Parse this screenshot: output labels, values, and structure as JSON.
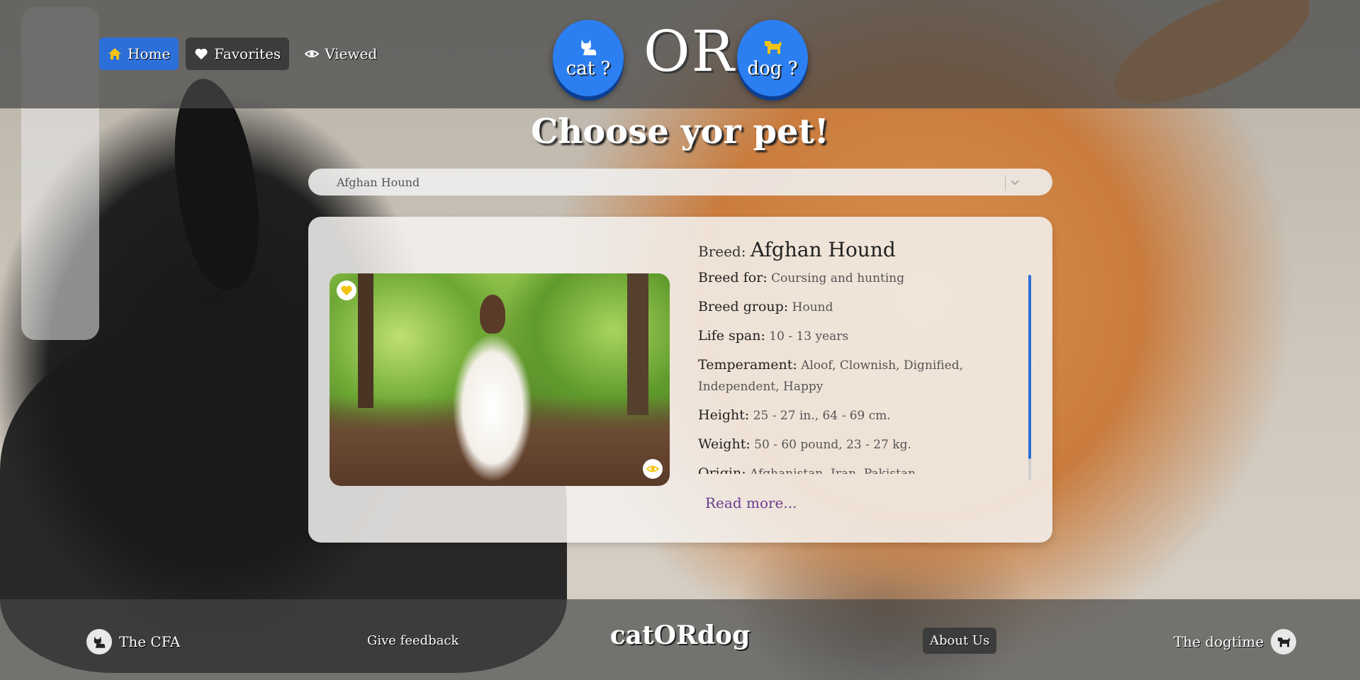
{
  "nav": {
    "home": "Home",
    "favorites": "Favorites",
    "viewed": "Viewed"
  },
  "picker": {
    "cat_label": "cat ?",
    "dog_label": "dog ?",
    "or_text": "OR",
    "cat_icon": "cat-icon",
    "dog_icon": "dog-icon"
  },
  "headline": "Choose yor pet!",
  "breed_select": {
    "value": "Afghan Hound"
  },
  "card": {
    "breed_label": "Breed:",
    "breed_name": "Afghan Hound",
    "details": [
      {
        "label": "Breed for:",
        "value": "Coursing and hunting"
      },
      {
        "label": "Breed group:",
        "value": "Hound"
      },
      {
        "label": "Life span:",
        "value": "10 - 13 years"
      },
      {
        "label": "Temperament:",
        "value": "Aloof, Clownish, Dignified, Independent, Happy"
      },
      {
        "label": "Height:",
        "value": "25 - 27 in., 64 - 69 cm."
      },
      {
        "label": "Weight:",
        "value": "50 - 60 pound, 23 - 27 kg."
      },
      {
        "label": "Origin:",
        "value": "Afghanistan, Iran, Pakistan"
      }
    ],
    "read_more": "Read more..."
  },
  "footer": {
    "cfa": "The CFA",
    "feedback": "Give feedback",
    "brand": "catORdog",
    "about": "About Us",
    "dogtime": "The dogtime"
  },
  "colors": {
    "accent": "#2d6fd8",
    "heart": "#f2c313",
    "link": "#6a3d8f"
  }
}
